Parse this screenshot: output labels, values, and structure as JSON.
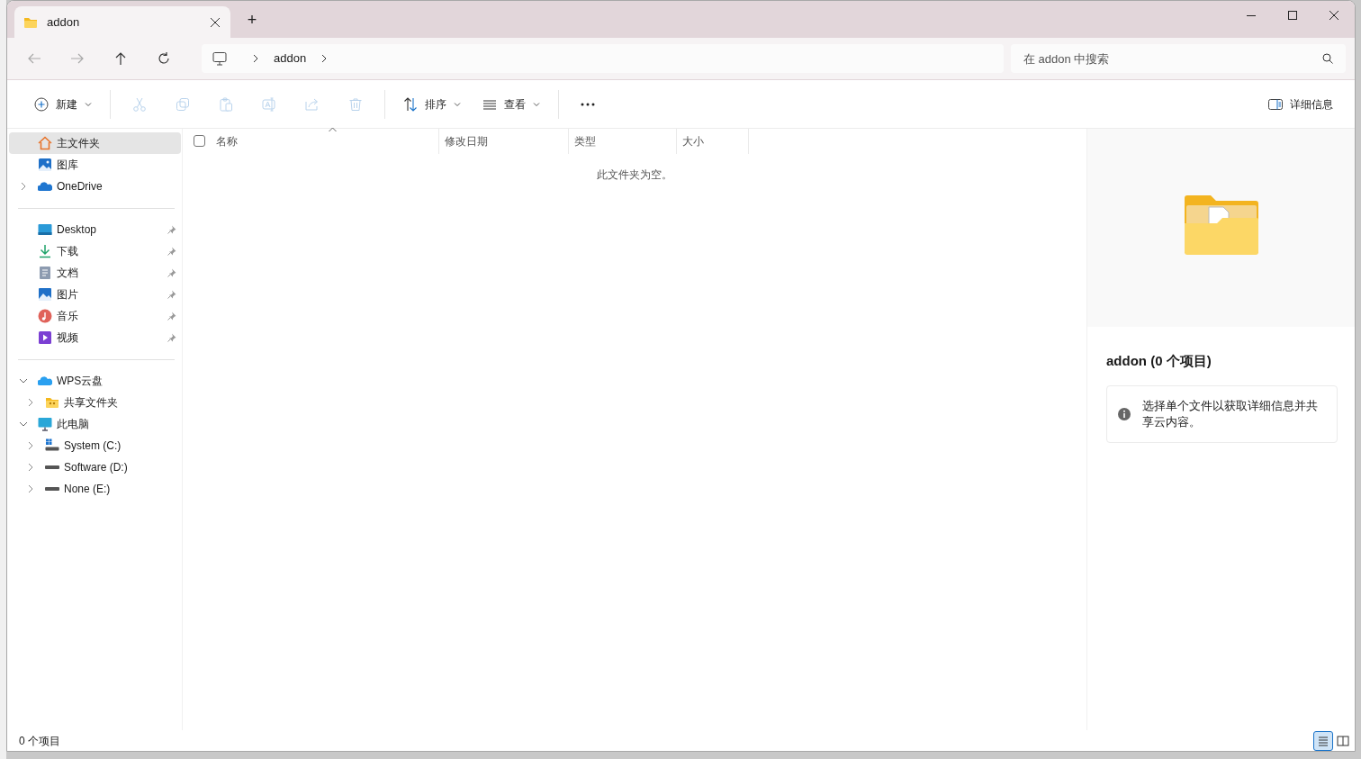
{
  "tabs": [
    {
      "title": "addon",
      "selected": true
    }
  ],
  "new_tab": "+",
  "nav_buttons": [
    {
      "kind": "back",
      "disabled": true
    },
    {
      "kind": "forward",
      "disabled": true
    },
    {
      "kind": "up",
      "disabled": false
    },
    {
      "kind": "refresh",
      "disabled": false
    }
  ],
  "address": {
    "crumbs": [
      "addon"
    ]
  },
  "search": {
    "placeholder": "在 addon 中搜索"
  },
  "command_bar": [
    {
      "kind": "new",
      "label": "新建",
      "disabled": false
    },
    {
      "kind": "separator"
    },
    {
      "kind": "cut",
      "disabled": true
    },
    {
      "kind": "copy",
      "disabled": true
    },
    {
      "kind": "paste",
      "disabled": true
    },
    {
      "kind": "rename",
      "disabled": true
    },
    {
      "kind": "share",
      "disabled": true
    },
    {
      "kind": "delete",
      "disabled": true
    },
    {
      "kind": "separator"
    },
    {
      "kind": "sort",
      "label": "排序",
      "disabled": false
    },
    {
      "kind": "view",
      "label": "查看",
      "disabled": false
    },
    {
      "kind": "separator"
    },
    {
      "kind": "more"
    }
  ],
  "details_button": {
    "label": "详细信息"
  },
  "sidebar": {
    "groups": [
      [
        {
          "kind": "home",
          "label": "主文件夹",
          "selected": true
        },
        {
          "kind": "gallery",
          "label": "图库",
          "selected": false
        },
        {
          "kind": "onedrive",
          "label": "OneDrive",
          "selected": false,
          "expanded": false
        }
      ],
      [
        {
          "kind": "desktop",
          "label": "Desktop",
          "selected": false,
          "pinned": true
        },
        {
          "kind": "download",
          "label": "下载",
          "selected": false,
          "pinned": true
        },
        {
          "kind": "documents",
          "label": "文档",
          "selected": false,
          "pinned": true
        },
        {
          "kind": "pictures",
          "label": "图片",
          "selected": false,
          "pinned": true
        },
        {
          "kind": "music",
          "label": "音乐",
          "selected": false,
          "pinned": true
        },
        {
          "kind": "videos",
          "label": "视频",
          "selected": false,
          "pinned": true
        }
      ],
      [
        {
          "kind": "wps",
          "label": "WPS云盘",
          "selected": false,
          "expanded": true,
          "children": [
            {
              "kind": "shared",
              "label": "共享文件夹",
              "selected": false,
              "expanded": false
            }
          ]
        },
        {
          "kind": "computer",
          "label": "此电脑",
          "selected": false,
          "expanded": true,
          "children": [
            {
              "kind": "system-drive",
              "label": "System (C:)",
              "selected": false,
              "expanded": false
            },
            {
              "kind": "drive",
              "label": "Software (D:)",
              "selected": false,
              "expanded": false
            },
            {
              "kind": "drive",
              "label": "None (E:)",
              "selected": false,
              "expanded": false
            }
          ]
        }
      ]
    ]
  },
  "file_list": {
    "select_all": {
      "checked": false
    },
    "columns": [
      {
        "label": "名称",
        "sorted": true
      },
      {
        "label": "修改日期",
        "sorted": false
      },
      {
        "label": "类型",
        "sorted": false
      },
      {
        "label": "大小",
        "sorted": false
      }
    ],
    "empty_message": "此文件夹为空。"
  },
  "details": {
    "title": "addon (0 个项目)",
    "info": "选择单个文件以获取详细信息并共享云内容。"
  },
  "status_bar": {
    "count": "0 个项目",
    "views": [
      {
        "kind": "details",
        "selected": true
      },
      {
        "kind": "tiles",
        "selected": false
      }
    ]
  }
}
